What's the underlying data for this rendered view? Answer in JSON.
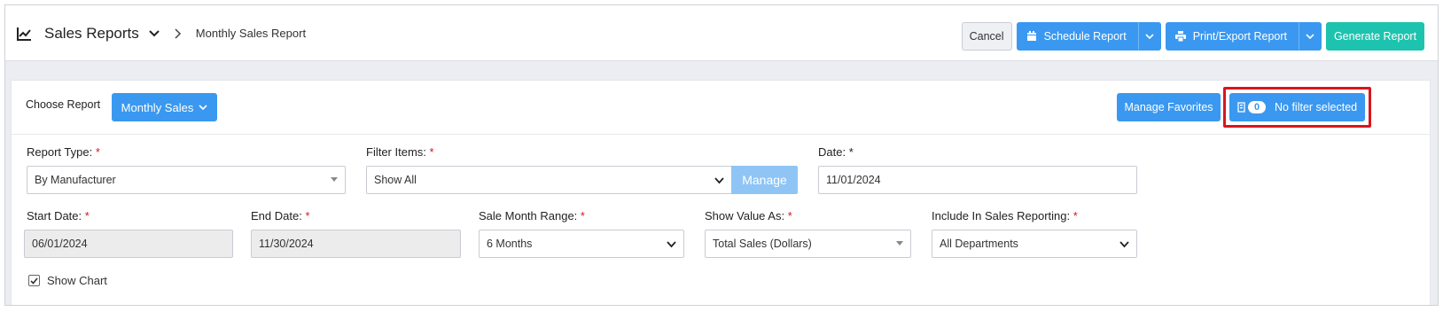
{
  "header": {
    "title": "Sales Reports",
    "breadcrumb": "Monthly Sales Report",
    "buttons": {
      "cancel": "Cancel",
      "schedule": "Schedule Report",
      "print_export": "Print/Export Report",
      "generate": "Generate Report"
    }
  },
  "report_bar": {
    "choose_label": "Choose Report",
    "selected_report": "Monthly Sales",
    "manage_favorites": "Manage Favorites",
    "filter_count": "0",
    "filter_status": "No filter selected"
  },
  "form": {
    "report_type": {
      "label": "Report Type:",
      "required": "*",
      "value": "By Manufacturer"
    },
    "filter_items": {
      "label": "Filter Items:",
      "required": "*",
      "value": "Show All",
      "manage_label": "Manage"
    },
    "date": {
      "label": "Date:",
      "required": "*",
      "value": "11/01/2024"
    },
    "start_date": {
      "label": "Start Date:",
      "required": "*",
      "value": "06/01/2024"
    },
    "end_date": {
      "label": "End Date:",
      "required": "*",
      "value": "11/30/2024"
    },
    "sale_month_range": {
      "label": "Sale Month Range:",
      "required": "*",
      "value": "6 Months"
    },
    "show_value_as": {
      "label": "Show Value As:",
      "required": "*",
      "value": "Total Sales (Dollars)"
    },
    "include_in_sales": {
      "label": "Include In Sales Reporting:",
      "required": "*",
      "value": "All Departments"
    },
    "show_chart": {
      "label": "Show Chart",
      "checked": true
    }
  },
  "colors": {
    "primary": "#3a98f0",
    "teal": "#1dc3ae",
    "required": "#d8161c",
    "highlight": "#d8161c"
  }
}
